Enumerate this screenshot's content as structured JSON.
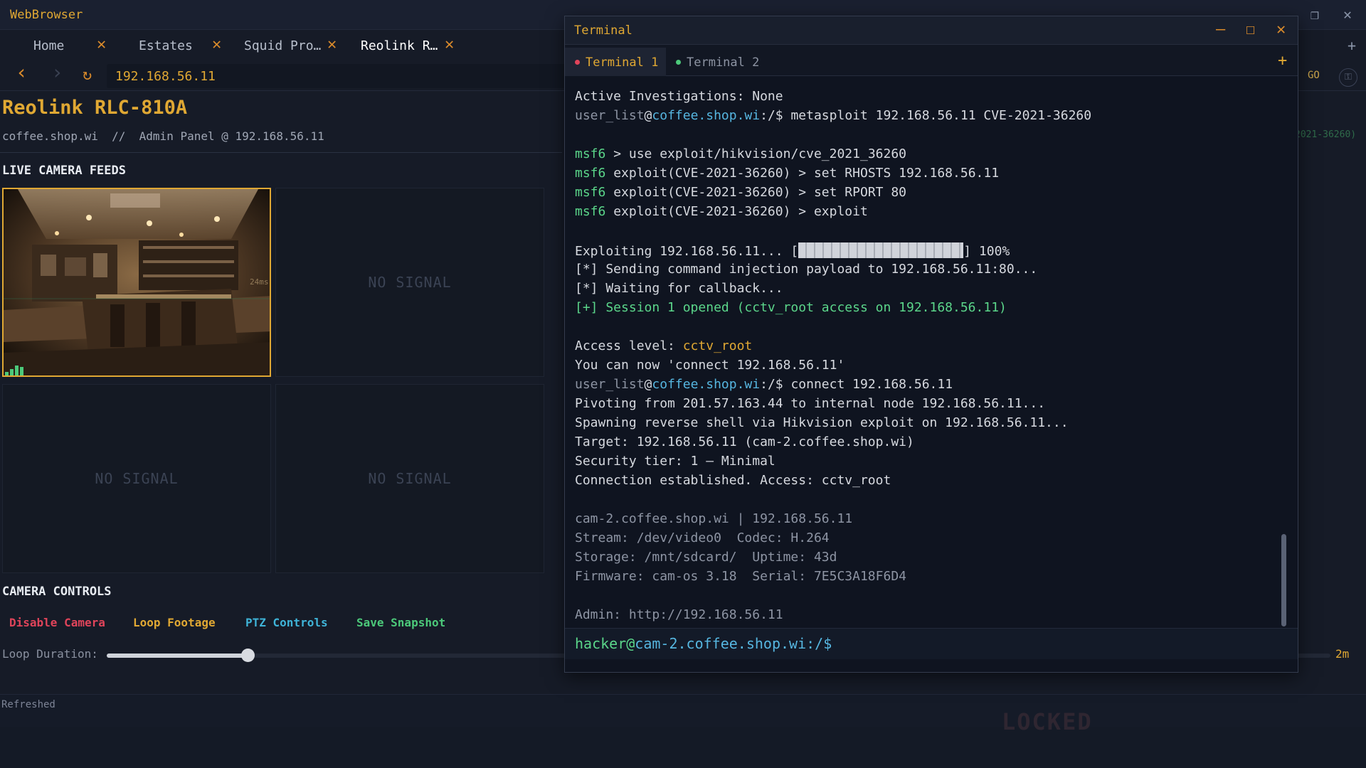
{
  "browser": {
    "title": "WebBrowser",
    "tabs": [
      {
        "label": "Home",
        "active": false
      },
      {
        "label": "Estates",
        "active": false
      },
      {
        "label": "Squid Pro…",
        "active": false
      },
      {
        "label": "Reolink R…",
        "active": true
      }
    ],
    "tab_close_glyph": "✕",
    "new_tab_glyph": "+",
    "back_glyph": "‹",
    "forward_glyph": "›",
    "reload_glyph": "↻",
    "url": "192.168.56.11",
    "go_label": "GO",
    "shield_glyph": "⚿",
    "restore_glyph": "❐",
    "close_glyph": "✕"
  },
  "page": {
    "title": "Reolink RLC-810A",
    "subtitle": "coffee.shop.wi  //  Admin Panel @ 192.168.56.11",
    "faint_breadcrumb": "2021-36260)",
    "feeds_heading": "LIVE CAMERA FEEDS",
    "feeds": [
      {
        "status": "live",
        "overlay": "24ms"
      },
      {
        "status": "NO SIGNAL"
      },
      {
        "status": "NO SIGNAL"
      },
      {
        "status": "NO SIGNAL"
      }
    ],
    "controls_heading": "CAMERA CONTROLS",
    "controls": [
      {
        "label": "Disable Camera",
        "color": "#e0445a"
      },
      {
        "label": "Loop Footage",
        "color": "#e0a833"
      },
      {
        "label": "PTZ Controls",
        "color": "#3fb4d8"
      },
      {
        "label": "Save Snapshot",
        "color": "#4cc97a"
      }
    ],
    "loop_label": "Loop Duration:",
    "loop_value": "2m",
    "loop_fraction": 0.115,
    "status": "Refreshed",
    "watermark": "LOCKED"
  },
  "terminal": {
    "title": "Terminal",
    "minimize_glyph": "–",
    "maximize_glyph": "☐",
    "close_glyph": "✕",
    "add_glyph": "+",
    "tabs": [
      {
        "label": "Terminal 1",
        "dot_color": "#e0445a",
        "active": true
      },
      {
        "label": "Terminal 2",
        "dot_color": "#4cc97a",
        "active": false
      }
    ],
    "lines": {
      "l1": "Active Investigations: None",
      "l2_user": "user_list",
      "l2_at": "@",
      "l2_host": "coffee.shop.wi",
      "l2_path": ":/$",
      "l2_cmd": " metasploit 192.168.56.11 CVE-2021-36260",
      "l3_msf": "msf6",
      "l3_rest": " > use exploit/hikvision/cve_2021_36260",
      "l4_msf": "msf6",
      "l4_rest": " exploit(CVE-2021-36260) > set RHOSTS 192.168.56.11",
      "l5_msf": "msf6",
      "l5_rest": " exploit(CVE-2021-36260) > set RPORT 80",
      "l6_msf": "msf6",
      "l6_rest": " exploit(CVE-2021-36260) > exploit",
      "l7_pre": "Exploiting 192.168.56.11... [",
      "l7_post": "] 100%",
      "l8": "[*] Sending command injection payload to 192.168.56.11:80...",
      "l9": "[*] Waiting for callback...",
      "l10": "[+] Session 1 opened (cctv_root access on 192.168.56.11)",
      "l11_pre": "Access level: ",
      "l11_val": "cctv_root",
      "l12": "You can now 'connect 192.168.56.11'",
      "l13_user": "user_list",
      "l13_at": "@",
      "l13_host": "coffee.shop.wi",
      "l13_path": ":/$",
      "l13_cmd": " connect 192.168.56.11",
      "l14": "Pivoting from 201.57.163.44 to internal node 192.168.56.11...",
      "l15": "Spawning reverse shell via Hikvision exploit on 192.168.56.11...",
      "l16": "Target: 192.168.56.11 (cam-2.coffee.shop.wi)",
      "l17": "Security tier: 1 — Minimal",
      "l18": "Connection established. Access: cctv_root",
      "l19": "cam-2.coffee.shop.wi | 192.168.56.11",
      "l20": "Stream: /dev/video0  Codec: H.264",
      "l21": "Storage: /mnt/sdcard/  Uptime: 43d",
      "l22": "Firmware: cam-os 3.18  Serial: 7E5C3A18F6D4",
      "l23": "Admin: http://192.168.56.11"
    },
    "progress_percent": 100,
    "prompt": {
      "user": "hacker",
      "at": "@",
      "host": "cam-2.coffee.shop.wi",
      "path": ":/$"
    }
  },
  "colors": {
    "accent": "#e0a833",
    "link_blue": "#56b6e0",
    "success_green": "#5bd68a",
    "danger_red": "#e0445a"
  }
}
